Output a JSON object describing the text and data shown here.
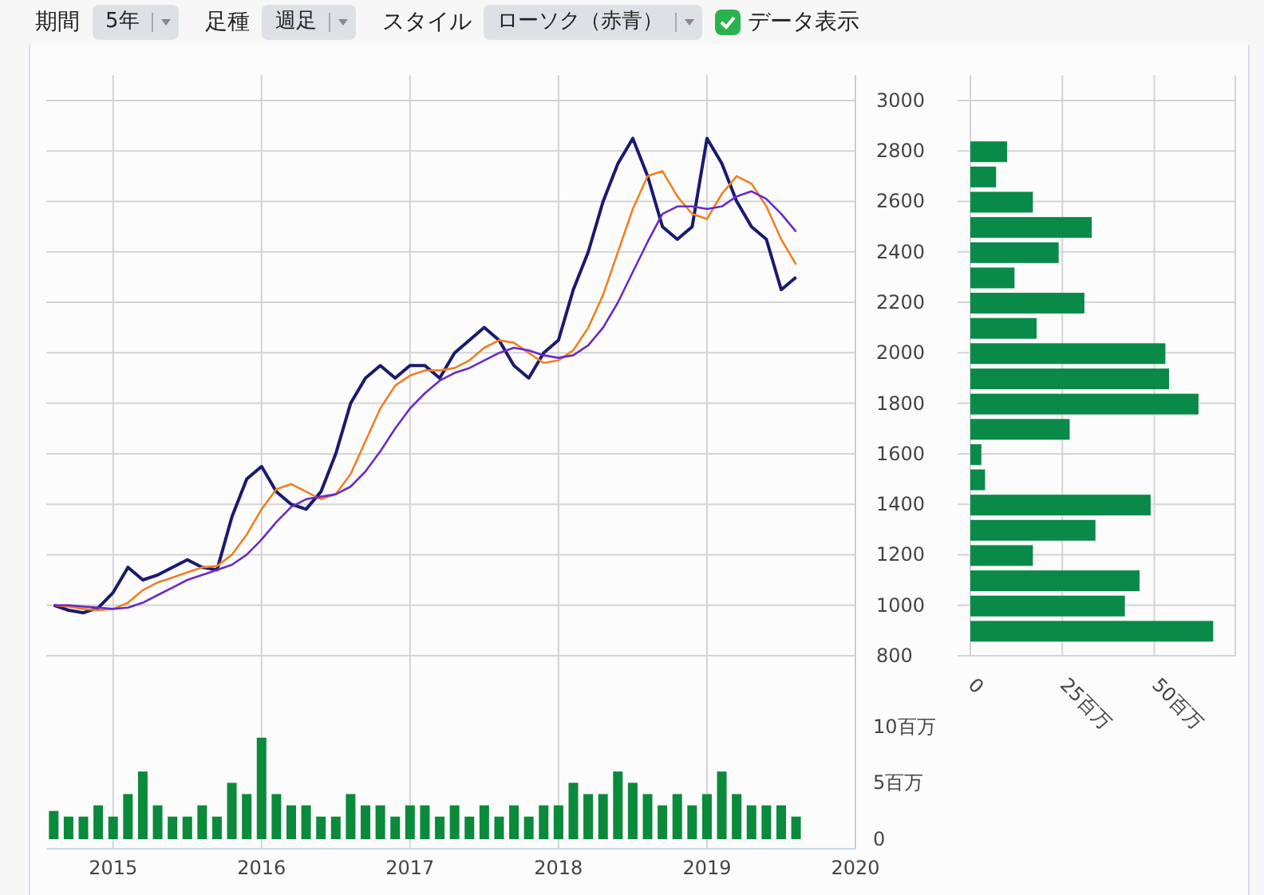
{
  "toolbar": {
    "period": {
      "label": "期間",
      "value": "5年"
    },
    "bar_type": {
      "label": "足種",
      "value": "週足"
    },
    "style": {
      "label": "スタイル",
      "value": "ローソク（赤青）"
    },
    "show_data": {
      "label": "データ表示",
      "checked": true
    }
  },
  "price_chart": {
    "chart_data": {
      "type": "line",
      "grid": true,
      "xlim": [
        2014.55,
        2020.0
      ],
      "ylim": [
        800,
        3100
      ],
      "yticks": [
        800,
        1000,
        1200,
        1400,
        1600,
        1800,
        2000,
        2200,
        2400,
        2600,
        2800,
        3000
      ],
      "x": [
        2014.6,
        2014.7,
        2014.8,
        2014.9,
        2015.0,
        2015.1,
        2015.2,
        2015.3,
        2015.4,
        2015.5,
        2015.6,
        2015.7,
        2015.8,
        2015.9,
        2016.0,
        2016.1,
        2016.2,
        2016.3,
        2016.4,
        2016.5,
        2016.6,
        2016.7,
        2016.8,
        2016.9,
        2017.0,
        2017.1,
        2017.2,
        2017.3,
        2017.4,
        2017.5,
        2017.6,
        2017.7,
        2017.8,
        2017.9,
        2018.0,
        2018.1,
        2018.2,
        2018.3,
        2018.4,
        2018.5,
        2018.6,
        2018.7,
        2018.8,
        2018.9,
        2019.0,
        2019.1,
        2019.2,
        2019.3,
        2019.4,
        2019.5,
        2019.6
      ],
      "series": [
        {
          "color": "#1a1a6e",
          "values": [
            1000,
            980,
            970,
            990,
            1050,
            1150,
            1100,
            1120,
            1150,
            1180,
            1150,
            1140,
            1350,
            1500,
            1550,
            1450,
            1400,
            1380,
            1450,
            1600,
            1800,
            1900,
            1950,
            1900,
            1950,
            1950,
            1900,
            2000,
            2050,
            2100,
            2050,
            1950,
            1900,
            2000,
            2050,
            2250,
            2400,
            2600,
            2750,
            2850,
            2700,
            2500,
            2450,
            2500,
            2850,
            2750,
            2600,
            2500,
            2450,
            2250,
            2300
          ]
        },
        {
          "color": "#f08020",
          "values": [
            1000,
            995,
            985,
            980,
            985,
            1010,
            1060,
            1090,
            1110,
            1130,
            1150,
            1155,
            1200,
            1280,
            1380,
            1460,
            1480,
            1450,
            1420,
            1440,
            1520,
            1650,
            1780,
            1870,
            1910,
            1930,
            1930,
            1940,
            1970,
            2020,
            2050,
            2040,
            2000,
            1960,
            1970,
            2010,
            2100,
            2230,
            2400,
            2570,
            2700,
            2720,
            2620,
            2550,
            2530,
            2630,
            2700,
            2670,
            2580,
            2450,
            2350
          ]
        },
        {
          "color": "#6a2bc8",
          "values": [
            1000,
            1000,
            995,
            990,
            985,
            990,
            1010,
            1040,
            1070,
            1100,
            1120,
            1140,
            1160,
            1200,
            1260,
            1330,
            1390,
            1420,
            1430,
            1440,
            1470,
            1530,
            1610,
            1700,
            1780,
            1840,
            1890,
            1920,
            1940,
            1970,
            2000,
            2020,
            2010,
            1990,
            1980,
            1990,
            2030,
            2100,
            2200,
            2320,
            2440,
            2550,
            2580,
            2580,
            2570,
            2580,
            2620,
            2640,
            2610,
            2550,
            2480
          ]
        }
      ]
    }
  },
  "volume_chart": {
    "chart_data": {
      "type": "bar",
      "grid": true,
      "xlim": [
        2014.55,
        2020.0
      ],
      "ylim": [
        0,
        15
      ],
      "xticks": [
        2015,
        2016,
        2017,
        2018,
        2019,
        2020
      ],
      "yticks": [
        {
          "value": 0,
          "label": "0"
        },
        {
          "value": 5,
          "label": "5百万"
        },
        {
          "value": 10,
          "label": "10百万"
        }
      ],
      "x": [
        2014.6,
        2014.7,
        2014.8,
        2014.9,
        2015.0,
        2015.1,
        2015.2,
        2015.3,
        2015.4,
        2015.5,
        2015.6,
        2015.7,
        2015.8,
        2015.9,
        2016.0,
        2016.1,
        2016.2,
        2016.3,
        2016.4,
        2016.5,
        2016.6,
        2016.7,
        2016.8,
        2016.9,
        2017.0,
        2017.1,
        2017.2,
        2017.3,
        2017.4,
        2017.5,
        2017.6,
        2017.7,
        2017.8,
        2017.9,
        2018.0,
        2018.1,
        2018.2,
        2018.3,
        2018.4,
        2018.5,
        2018.6,
        2018.7,
        2018.8,
        2018.9,
        2019.0,
        2019.1,
        2019.2,
        2019.3,
        2019.4,
        2019.5,
        2019.6
      ],
      "series": [
        {
          "color": "#0a8a3a",
          "values": [
            2.5,
            2,
            2,
            3,
            2,
            4,
            6,
            3,
            2,
            2,
            3,
            2,
            5,
            4,
            9,
            4,
            3,
            3,
            2,
            2,
            4,
            3,
            3,
            2,
            3,
            3,
            2,
            3,
            2,
            3,
            2,
            3,
            2,
            3,
            3,
            5,
            4,
            4,
            6,
            5,
            4,
            3,
            4,
            3,
            4,
            6,
            4,
            3,
            3,
            3,
            2
          ]
        }
      ]
    }
  },
  "volume_profile": {
    "chart_data": {
      "type": "bar",
      "orientation": "horizontal",
      "grid": true,
      "xlim": [
        0,
        72
      ],
      "xticks": [
        {
          "value": 0,
          "label": "0"
        },
        {
          "value": 25,
          "label": "25百万"
        },
        {
          "value": 50,
          "label": "50百万"
        }
      ],
      "series": [
        {
          "color": "#0a8a48",
          "values": [
            10,
            7,
            17,
            33,
            24,
            12,
            31,
            18,
            53,
            54,
            62,
            27,
            3,
            4,
            49,
            34,
            17,
            46,
            42,
            66
          ]
        }
      ]
    }
  }
}
